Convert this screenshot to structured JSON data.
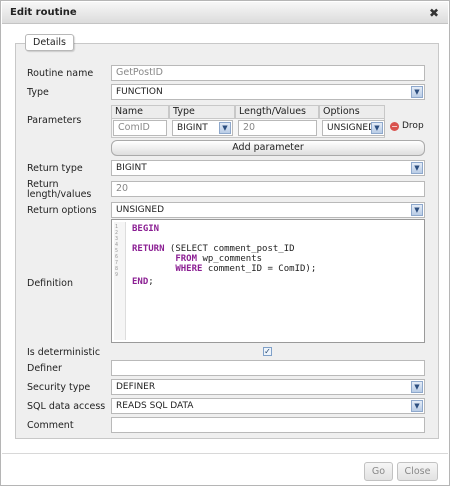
{
  "dialog": {
    "title": "Edit routine",
    "close_glyph": "✖"
  },
  "tabs": {
    "details": "Details"
  },
  "form": {
    "routine_name": {
      "label": "Routine name",
      "value": "GetPostID"
    },
    "type": {
      "label": "Type",
      "value": "FUNCTION"
    },
    "parameters": {
      "label": "Parameters",
      "headers": {
        "name": "Name",
        "type": "Type",
        "length": "Length/Values",
        "options": "Options"
      },
      "rows": [
        {
          "name": "ComID",
          "type": "BIGINT",
          "length": "20",
          "options": "UNSIGNED",
          "drop_label": "Drop"
        }
      ],
      "add_label": "Add parameter"
    },
    "return_type": {
      "label": "Return type",
      "value": "BIGINT"
    },
    "return_length": {
      "label_line1": "Return",
      "label_line2": "length/values",
      "value": "20"
    },
    "return_options": {
      "label": "Return options",
      "value": "UNSIGNED"
    },
    "definition": {
      "label": "Definition",
      "line_numbers": [
        "1",
        "2",
        "3",
        "4",
        "5",
        "6",
        "7",
        "8",
        "9"
      ],
      "lines": [
        {
          "kw": "BEGIN",
          "rest": ""
        },
        {
          "kw": "",
          "rest": ""
        },
        {
          "kw": "RETURN",
          "rest": " (SELECT comment_post_ID"
        },
        {
          "kw": "        FROM",
          "rest": " wp_comments"
        },
        {
          "kw": "        WHERE",
          "rest": " comment_ID = ComID);"
        },
        {
          "kw": "END",
          "rest": ";"
        }
      ]
    },
    "is_deterministic": {
      "label": "Is deterministic",
      "checked": true,
      "glyph": "✓"
    },
    "definer": {
      "label": "Definer",
      "value": ""
    },
    "security_type": {
      "label": "Security type",
      "value": "DEFINER"
    },
    "sql_data_access": {
      "label": "SQL data access",
      "value": "READS SQL DATA"
    },
    "comment": {
      "label": "Comment",
      "value": ""
    }
  },
  "footer": {
    "go_label": "Go",
    "close_label": "Close"
  },
  "icons": {
    "caret": "▼",
    "drop": "−"
  }
}
